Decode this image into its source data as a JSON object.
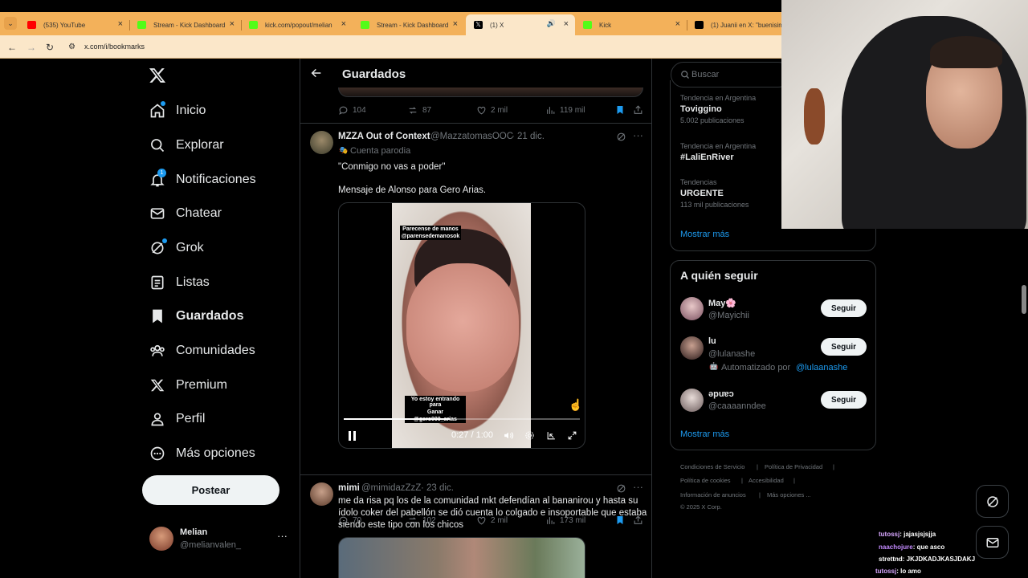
{
  "browser": {
    "tabs": [
      {
        "label": "(535) YouTube",
        "color": "#ff0000"
      },
      {
        "label": "Stream - Kick Dashboard",
        "color": "#53fc18"
      },
      {
        "label": "kick.com/popout/melian",
        "color": "#53fc18"
      },
      {
        "label": "Stream - Kick Dashboard",
        "color": "#53fc18"
      },
      {
        "label": "(1) X",
        "color": "#000000"
      },
      {
        "label": "Kick",
        "color": "#53fc18"
      },
      {
        "label": "(1) Juanii en X: \"buenisim",
        "color": "#000000"
      }
    ],
    "url": "x.com/i/bookmarks"
  },
  "nav": {
    "items": [
      {
        "label": "Inicio",
        "icon": "home-icon"
      },
      {
        "label": "Explorar",
        "icon": "search-icon"
      },
      {
        "label": "Notificaciones",
        "icon": "bell-icon",
        "badge": "1"
      },
      {
        "label": "Chatear",
        "icon": "mail-icon"
      },
      {
        "label": "Grok",
        "icon": "grok-icon"
      },
      {
        "label": "Listas",
        "icon": "list-icon"
      },
      {
        "label": "Guardados",
        "icon": "bookmark-icon"
      },
      {
        "label": "Comunidades",
        "icon": "people-icon"
      },
      {
        "label": "Premium",
        "icon": "x-logo-icon"
      },
      {
        "label": "Perfil",
        "icon": "person-icon"
      },
      {
        "label": "Más opciones",
        "icon": "more-circle-icon"
      }
    ],
    "post_label": "Postear",
    "profile": {
      "name": "Melian",
      "handle": "@melianvalen_"
    }
  },
  "header": {
    "title": "Guardados"
  },
  "prev_post_actions": {
    "replies": "104",
    "reposts": "87",
    "likes": "2 mil",
    "views": "119 mil"
  },
  "tweet1": {
    "name": "MZZA Out of Context",
    "handle": "@MazzatomasOOC",
    "date": "· 21 dic.",
    "parody": "Cuenta parodia",
    "text1": "\"Conmigo no vas a poder\"",
    "text2": "Mensaje de Alonso para Gero Arias.",
    "video": {
      "caption_top_1": "Parecense de manos",
      "caption_top_2": "@parensedemanosok",
      "caption_bottom_1": "Yo estoy entrando para",
      "caption_bottom_2": "Ganar",
      "caption_bottom_3": "@gero000_arias",
      "time": "0:27 / 1:00",
      "progress": 0.45
    },
    "actions": {
      "replies": "70",
      "reposts": "102",
      "likes": "2 mil",
      "views": "173 mil"
    }
  },
  "tweet2": {
    "name": "mimi",
    "handle": "@mimidazZzZ",
    "date": "· 23 dic.",
    "text": "me da risa pq los de la comunidad mkt defendían al bananirou y hasta su ídolo coker del pabellón se dió cuenta lo colgado e insoportable que estaba siendo este tipo con los chicos"
  },
  "search": {
    "placeholder": "Buscar"
  },
  "trends": [
    {
      "meta": "Tendencia en Argentina",
      "name": "Toviggino",
      "count": "5.002 publicaciones"
    },
    {
      "meta": "Tendencia en Argentina",
      "name": "#LaliEnRiver",
      "count": ""
    },
    {
      "meta": "Tendencias",
      "name": "URGENTE",
      "count": "113 mil publicaciones"
    }
  ],
  "show_more": "Mostrar más",
  "who_to_follow": {
    "title": "A quién seguir",
    "users": [
      {
        "name": "May🌸",
        "handle": "@Mayichii",
        "extra": ""
      },
      {
        "name": "lu",
        "handle": "@lulanashe",
        "extra": "Automatizado por",
        "extra_link": "@lulaanashe"
      },
      {
        "name": "ǝpuɐɔ",
        "handle": "@caaaanndee",
        "extra": ""
      }
    ],
    "follow_label": "Seguir",
    "show_more": "Mostrar más"
  },
  "footer": {
    "links": [
      "Condiciones de Servicio",
      "Política de Privacidad",
      "Política de cookies",
      "Accesibilidad",
      "Información de anuncios",
      "Más opciones ..."
    ],
    "copyright": "© 2025 X Corp."
  },
  "chat": [
    {
      "user": "tutossj",
      "msg": ": jajasjsjsjja",
      "color": "#d8a7ff"
    },
    {
      "user": "naachojure",
      "msg": ": que asco",
      "color": "#c48bff"
    },
    {
      "user": "strettnd",
      "msg": ": JKJDKADJKASJDAKJ",
      "color": "#ffffff"
    },
    {
      "user": "tutossj",
      "msg": ": lo amo",
      "color": "#d8a7ff"
    }
  ]
}
